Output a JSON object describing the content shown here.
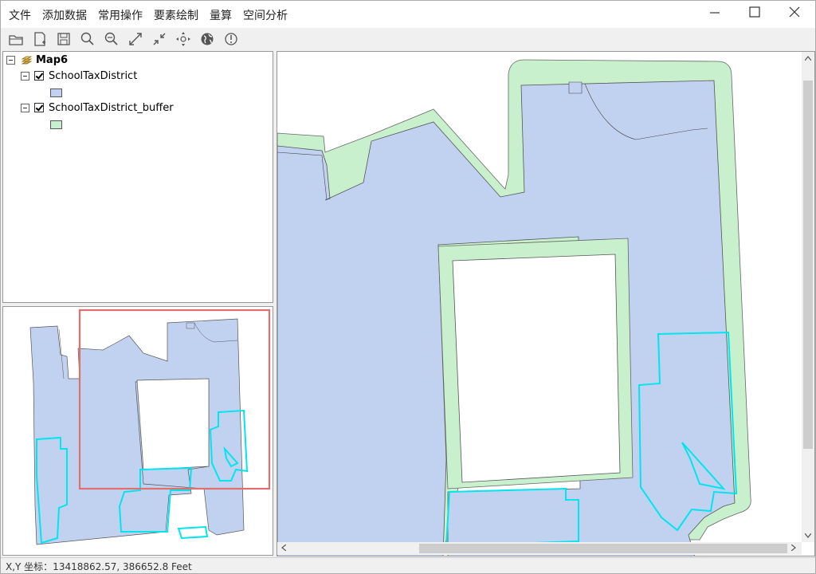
{
  "menu": {
    "items": [
      "文件",
      "添加数据",
      "常用操作",
      "要素绘制",
      "量算",
      "空间分析"
    ]
  },
  "window_controls": {
    "minimize_icon": "minimize-icon",
    "maximize_icon": "maximize-icon",
    "close_icon": "close-icon"
  },
  "toolbar": {
    "tools": [
      "open-folder-icon",
      "new-document-icon",
      "save-icon",
      "zoom-in-icon",
      "zoom-out-icon",
      "full-extent-icon",
      "fixed-zoom-in-icon",
      "pan-icon",
      "globe-icon",
      "info-icon"
    ]
  },
  "toc": {
    "map_name": "Map6",
    "layers": [
      {
        "name": "SchoolTaxDistrict",
        "checked": true,
        "fill": "#c0d2f0"
      },
      {
        "name": "SchoolTaxDistrict_buffer",
        "checked": true,
        "fill": "#c8f0cc"
      }
    ]
  },
  "colors": {
    "district_fill": "#c0d2f0",
    "buffer_fill": "#c8f0cc",
    "selection_outline": "#00e5ee",
    "extent_box": "#e07070"
  },
  "status": {
    "text": "X,Y 坐标：13418862.57, 386652.8  Feet"
  }
}
